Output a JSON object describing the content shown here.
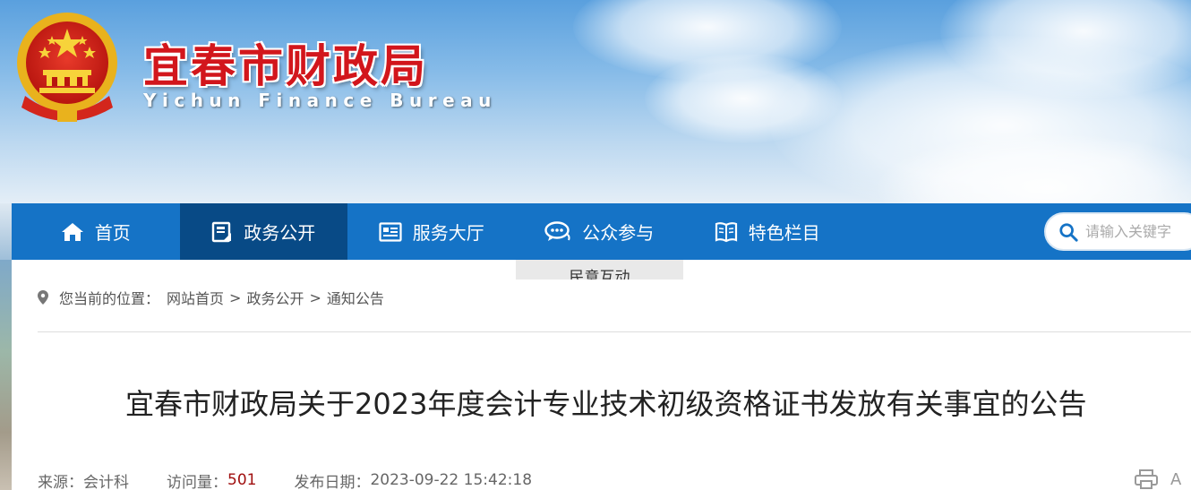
{
  "header": {
    "title": "宜春市财政局",
    "subtitle": "Yichun Finance Bureau"
  },
  "nav": {
    "items": [
      {
        "label": "首页",
        "icon": "home-icon"
      },
      {
        "label": "政务公开",
        "icon": "document-icon",
        "active": true
      },
      {
        "label": "服务大厅",
        "icon": "service-hall-icon"
      },
      {
        "label": "公众参与",
        "icon": "chat-icon"
      },
      {
        "label": "特色栏目",
        "icon": "book-icon"
      }
    ],
    "dropdown_item": "民意互动",
    "search_placeholder": "请输入关键字"
  },
  "breadcrumb": {
    "prefix": "您当前的位置：",
    "items": [
      "网站首页",
      "政务公开",
      "通知公告"
    ],
    "separator": ">"
  },
  "article": {
    "title": "宜春市财政局关于2023年度会计专业技术初级资格证书发放有关事宜的公告",
    "source_label": "来源：",
    "source": "会计科",
    "views_label": "访问量：",
    "views": "501",
    "date_label": "发布日期：",
    "date": "2023-09-22 15:42:18",
    "font_tool": "A"
  },
  "colors": {
    "nav": "#1573c6",
    "nav_active": "#084a86",
    "title_red": "#d2161c",
    "views_red": "#a01010"
  }
}
